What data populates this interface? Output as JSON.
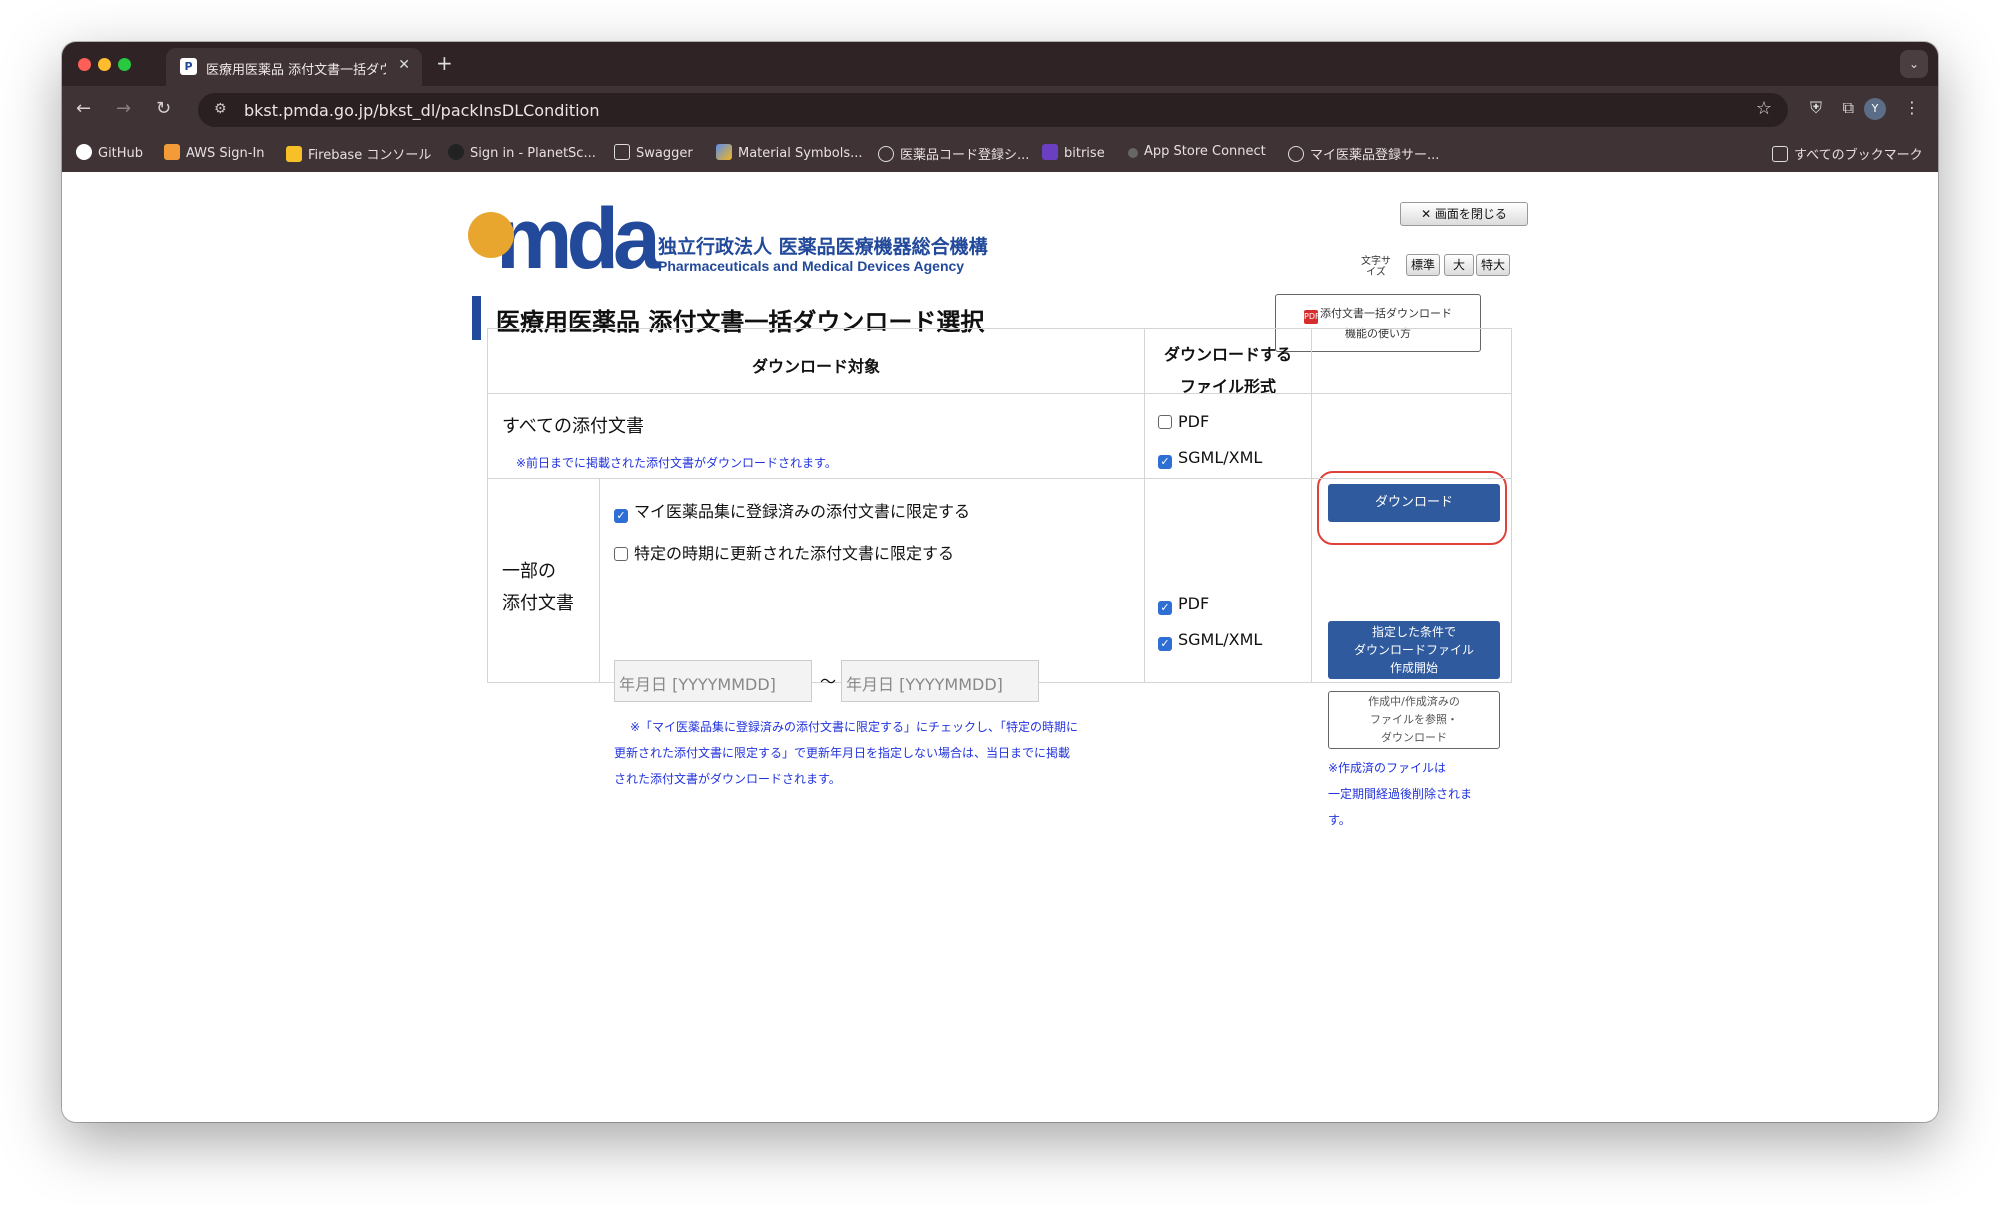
{
  "browser": {
    "tab_title": "医療用医薬品 添付文書一括ダウン",
    "favicon_text": "P",
    "close_tab": "✕",
    "new_tab": "+",
    "tab_menu": "⌄",
    "url": "bkst.pmda.go.jp/bkst_dl/packInsDLCondition",
    "back": "←",
    "forward": "→",
    "reload": "↻",
    "star": "☆",
    "profile_initial": "Y",
    "more": "⋮",
    "bookmarks": [
      {
        "label": "GitHub",
        "color": "#ffffff"
      },
      {
        "label": "AWS Sign-In",
        "color": "#f29b38"
      },
      {
        "label": "Firebase コンソール",
        "color": "#f6c026"
      },
      {
        "label": "Sign in - PlanetSc...",
        "color": "#222222"
      },
      {
        "label": "Swagger",
        "color": "#3f3335"
      },
      {
        "label": "Material Symbols...",
        "color": "#5b8def"
      },
      {
        "label": "医薬品コード登録シ...",
        "color": "#9a9a9a"
      },
      {
        "label": "bitrise",
        "color": "#6b3fc1"
      },
      {
        "label": "App Store Connect",
        "color": "#888888"
      },
      {
        "label": "マイ医薬品登録サー...",
        "color": "#9a9a9a"
      }
    ],
    "all_bookmarks": "すべてのブックマーク"
  },
  "page": {
    "logo_text": "mda",
    "org_jp": "独立行政法人 医薬品医療機器総合機構",
    "org_en": "Pharmaceuticals and Medical Devices Agency",
    "close_window": "✕ 画面を閉じる",
    "font_size_label": "文字サイズ",
    "font_sizes": [
      "標準",
      "大",
      "特大"
    ],
    "title": "医療用医薬品 添付文書一括ダウンロード選択",
    "howto_line1": "添付文書一括ダウンロード",
    "howto_line2": "機能の使い方",
    "pdf_icon": "PDF"
  },
  "table": {
    "col_target": "ダウンロード対象",
    "col_format_1": "ダウンロードする",
    "col_format_2": "ファイル形式",
    "row_all": {
      "label": "すべての添付文書",
      "note": "※前日までに掲載された添付文書がダウンロードされます。",
      "pdf": "PDF",
      "sgml": "SGML/XML",
      "download": "ダウンロード"
    },
    "row_partial": {
      "label_1": "一部の",
      "label_2": "添付文書",
      "opt_my": "マイ医薬品集に登録済みの添付文書に限定する",
      "opt_period": "特定の時期に更新された添付文書に限定する",
      "date_placeholder": "年月日 [YYYYMMDD]",
      "tilde": "〜",
      "note_1": "※「マイ医薬品集に登録済みの添付文書に限定する」にチェックし、「特定の時期に",
      "note_2": "更新された添付文書に限定する」で更新年月日を指定しない場合は、当日までに掲載",
      "note_3": "された添付文書がダウンロードされます。",
      "pdf": "PDF",
      "sgml": "SGML/XML",
      "create_1": "指定した条件で",
      "create_2": "ダウンロードファイル",
      "create_3": "作成開始",
      "ref_1": "作成中/作成済みの",
      "ref_2": "ファイルを参照・",
      "ref_3": "ダウンロード",
      "expire_1": "※作成済のファイルは",
      "expire_2": "一定期間経過後削除されま",
      "expire_3": "す。"
    }
  },
  "checkbox_states": {
    "all_pdf": false,
    "all_sgml": true,
    "opt_my": true,
    "opt_period": false,
    "part_pdf": true,
    "part_sgml": true
  }
}
